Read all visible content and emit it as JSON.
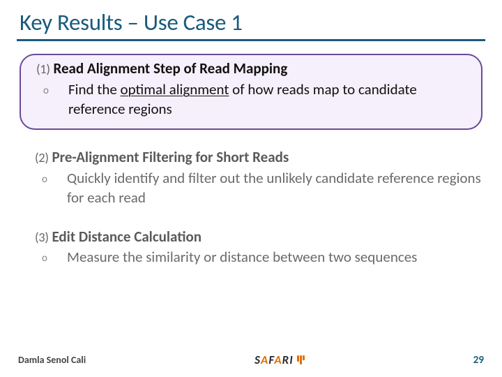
{
  "title": "Key Results – Use Case 1",
  "items": [
    {
      "label": "(1)",
      "heading": "Read Alignment Step of Read Mapping",
      "highlighted": true,
      "sub_pre": "Find the ",
      "sub_underlined": "optimal alignment",
      "sub_post": " of how reads map to candidate reference regions"
    },
    {
      "label": "(2)",
      "heading": "Pre-Alignment Filtering for Short Reads",
      "highlighted": false,
      "sub": "Quickly identify and filter out the unlikely candidate reference regions for each read"
    },
    {
      "label": "(3)",
      "heading": "Edit Distance Calculation",
      "highlighted": false,
      "sub": "Measure the similarity or distance between two sequences"
    }
  ],
  "footer": {
    "author": "Damla Senol Cali",
    "logo": "SAFARI",
    "page": "29"
  }
}
